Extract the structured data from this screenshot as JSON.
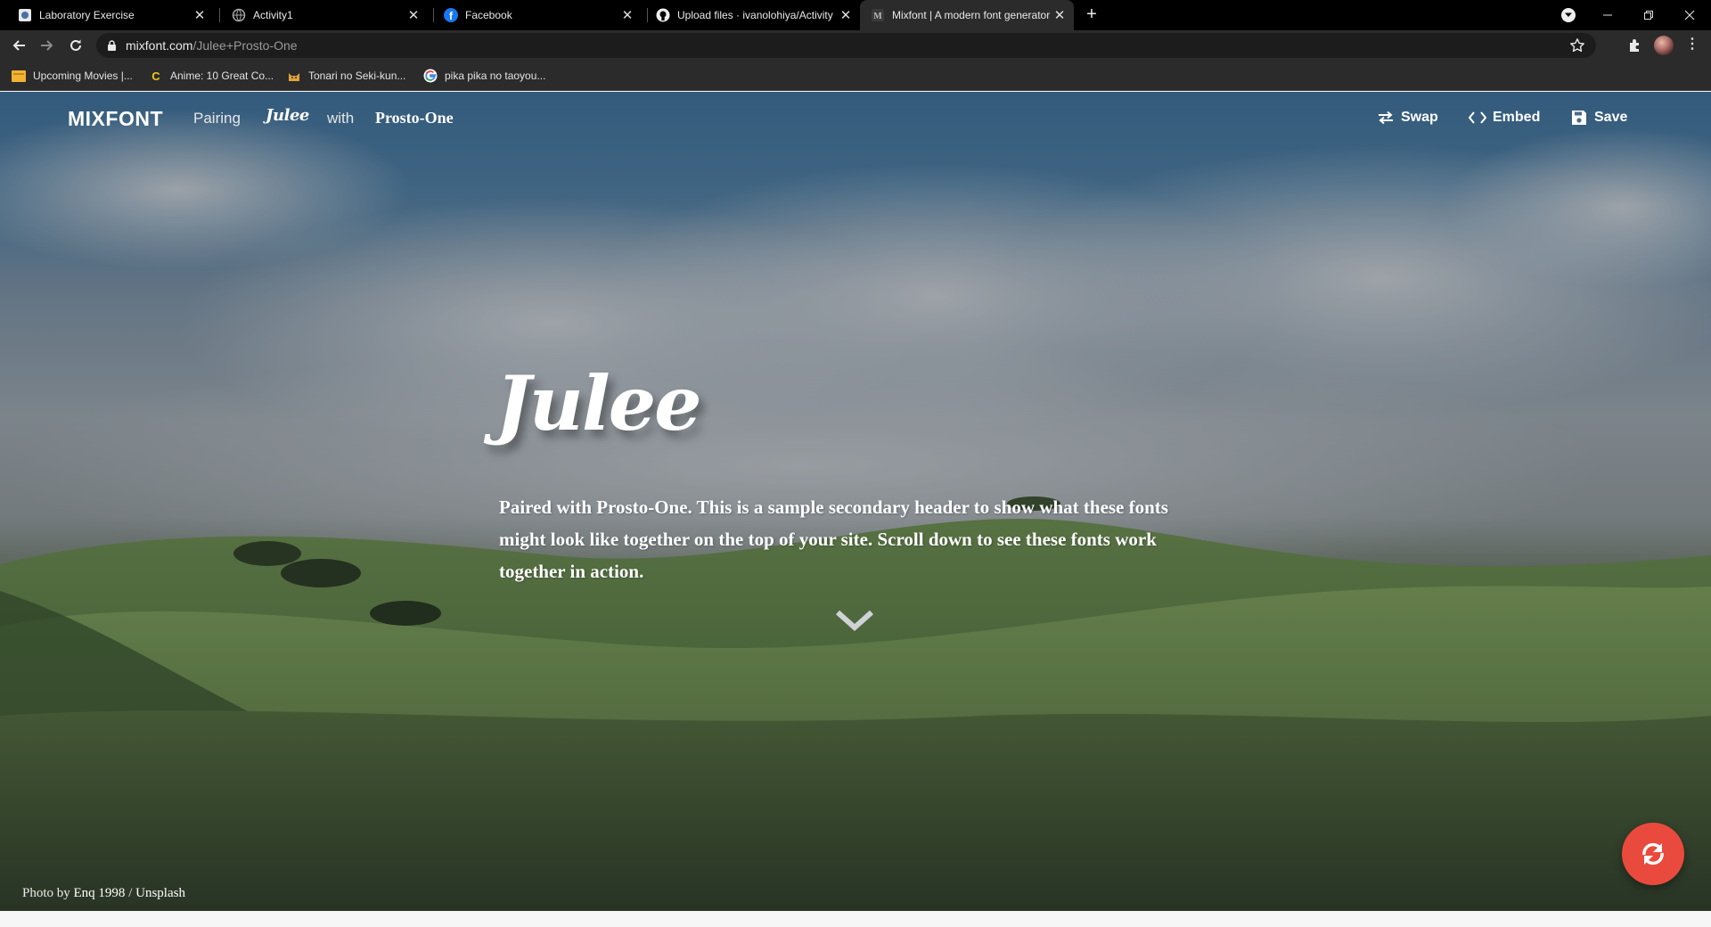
{
  "browser": {
    "tabs": [
      {
        "title": "Laboratory Exercise",
        "icon": "lab-favicon"
      },
      {
        "title": "Activity1",
        "icon": "globe-favicon"
      },
      {
        "title": "Facebook",
        "icon": "facebook-favicon"
      },
      {
        "title": "Upload files · ivanolohiya/Activity",
        "icon": "github-favicon"
      },
      {
        "title": "Mixfont | A modern font generator",
        "icon": "mixfont-favicon",
        "active": true
      }
    ],
    "url_host": "mixfont.com",
    "url_path": "/Julee+Prosto-One",
    "bookmarks": [
      {
        "label": "Upcoming Movies |...",
        "icon": "folder-favicon"
      },
      {
        "label": "Anime: 10 Great Co...",
        "icon": "c-favicon"
      },
      {
        "label": "Tonari no Seki-kun...",
        "icon": "cat-favicon"
      },
      {
        "label": "pika pika no taoyou...",
        "icon": "google-favicon"
      }
    ]
  },
  "nav": {
    "logo": "MIXFONT",
    "pairing_label": "Pairing",
    "heading_font": "Julee",
    "with_label": "with",
    "body_font": "Prosto-One",
    "actions": {
      "swap": "Swap",
      "embed": "Embed",
      "save": "Save"
    }
  },
  "hero": {
    "title": "Julee",
    "subtitle": "Paired with Prosto-One. This is a sample secondary header to show what these fonts might look like together on the top of your site. Scroll down to see these fonts work together in action."
  },
  "credit": {
    "prefix": "Photo by",
    "author": "Enq 1998",
    "separator": "/",
    "site": "Unsplash"
  },
  "colors": {
    "fab": "#ea4a3d",
    "chrome_dark": "#2b2b2b",
    "tabstrip": "#000000"
  }
}
